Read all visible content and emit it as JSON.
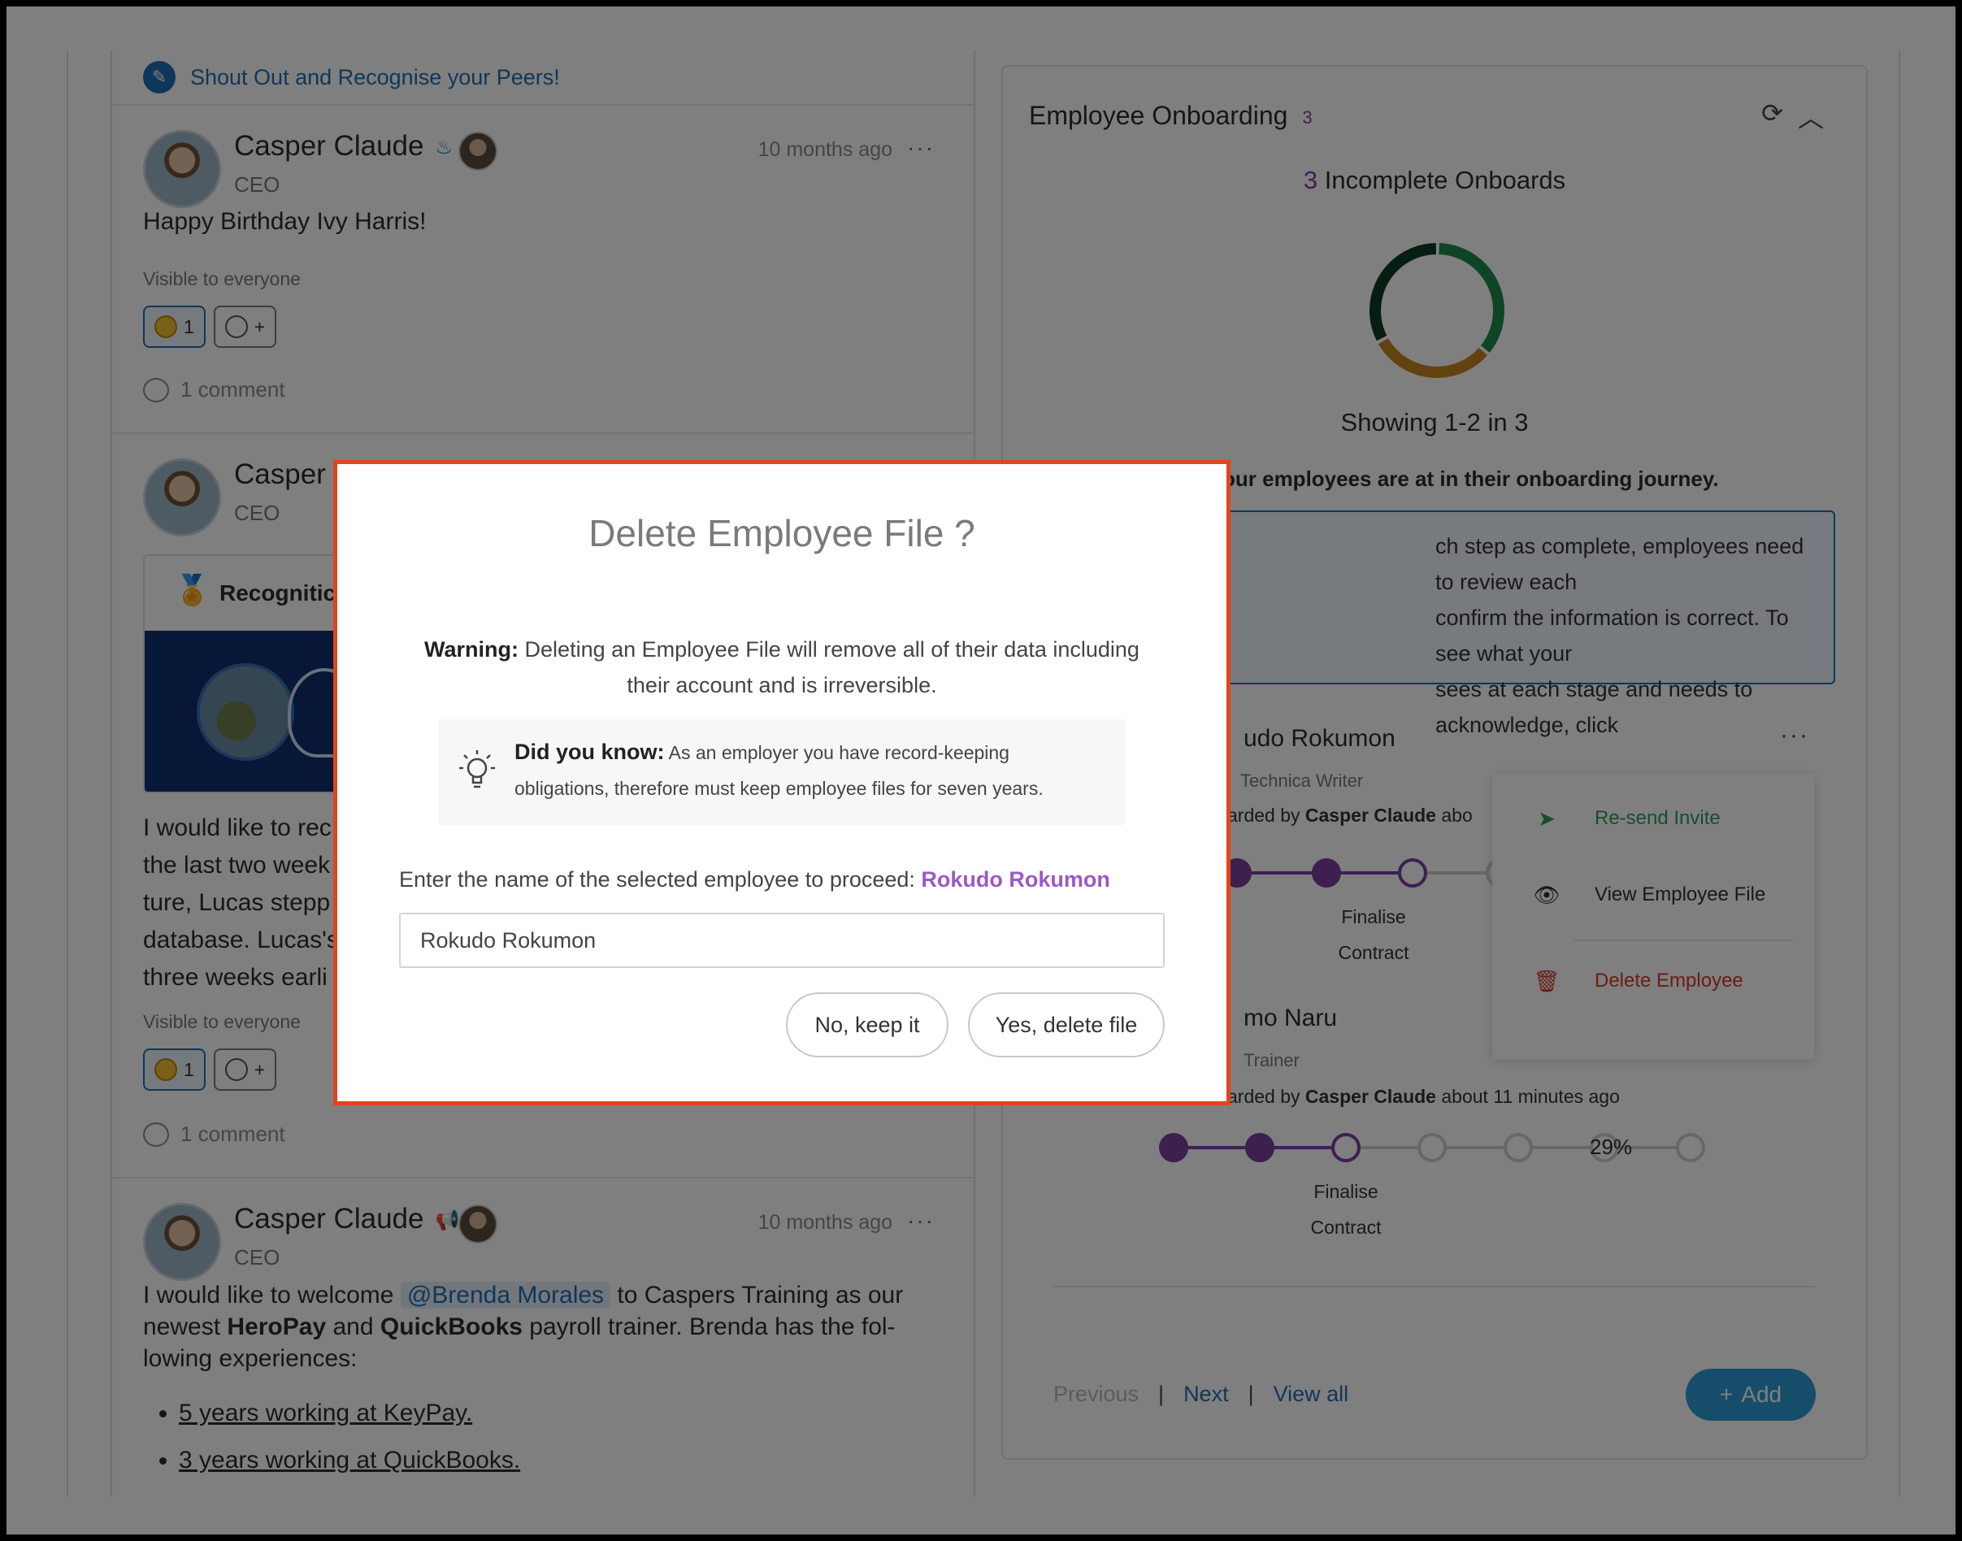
{
  "feed": {
    "shout_label": "Shout Out and Recognise your Peers!",
    "posts": [
      {
        "author": "Casper Claude",
        "role": "CEO",
        "time": "10 months ago",
        "more": "···",
        "text": "Happy Birthday Ivy Harris!",
        "visibility": "Visible to everyone",
        "reaction_count": "1",
        "add_reaction": "+",
        "comments": "1 comment"
      },
      {
        "author": "Casper",
        "role": "CEO",
        "recognition_label": "Recognitic",
        "text_lines": [
          "I would like to rec",
          "the last two week",
          "ture, Lucas stepp",
          "database. Lucas's",
          "three weeks earli"
        ],
        "visibility": "Visible to everyone",
        "reaction_count": "1",
        "add_reaction": "+",
        "comments": "1 comment"
      },
      {
        "author": "Casper Claude",
        "role": "CEO",
        "time": "10 months ago",
        "more": "···",
        "text_pre": "I would like to welcome",
        "mention": "@Brenda Morales",
        "text_mid": "to Caspers Training as our",
        "line2_pre": "newest",
        "bold1": "HeroPay",
        "line2_and": "and",
        "bold2": "QuickBooks",
        "line2_post": "payroll trainer. Brenda has the fol-",
        "line3": "lowing experiences:",
        "bullets": [
          "5 years working at KeyPay.",
          "3 years working at QuickBooks."
        ]
      }
    ]
  },
  "onboarding": {
    "title": "Employee Onboarding",
    "count": "3",
    "incomplete_count": "3",
    "incomplete_label": "Incomplete Onboards",
    "showing": "Showing 1-2 in 3",
    "journey_text": "our employees are at in their onboarding journey.",
    "info_lines": [
      "ch step as complete, employees need to review each",
      "confirm the information is correct. To see what your",
      "sees at each stage and needs to acknowledge, click"
    ],
    "employees": [
      {
        "name": "udo Rokumon",
        "role": "Technica Writer",
        "onboarded_pre": "arded by",
        "onboarded_by": "Casper Claude",
        "onboarded_post": "abo",
        "step_label_1": "Finalise",
        "step_label_2": "Contract",
        "more": "···"
      },
      {
        "name": "mo Naru",
        "role": "Trainer",
        "onboarded_pre": "arded by",
        "onboarded_by": "Casper Claude",
        "onboarded_post": "about 11 minutes ago",
        "step_label_1": "Finalise",
        "step_label_2": "Contract",
        "progress_pct": 29,
        "progress_text": "29%"
      }
    ],
    "donut": [
      {
        "label": "green",
        "fraction": 0.36,
        "color": "#1f8a4c"
      },
      {
        "label": "orange",
        "fraction": 0.31,
        "color": "#c5871f"
      },
      {
        "label": "dark",
        "fraction": 0.33,
        "color": "#0d3b22"
      }
    ],
    "pager": {
      "previous": "Previous",
      "sep": "|",
      "next": "Next",
      "view_all": "View all"
    },
    "add_label": "Add"
  },
  "context_menu": {
    "resend": "Re-send Invite",
    "view": "View Employee File",
    "delete": "Delete Employee"
  },
  "modal": {
    "title": "Delete Employee File ?",
    "warning_label": "Warning:",
    "warning_line1": "Deleting an Employee File will remove all of their data including",
    "warning_line2": "their account and is irreversible.",
    "tip_label": "Did you know:",
    "tip_line1": "As an employer you have record-keeping",
    "tip_line2": "obligations, therefore must keep employee files for seven years.",
    "prompt": "Enter the name of the selected employee to proceed:",
    "employee_name": "Rokudo Rokumon",
    "input_value": "Rokudo Rokumon",
    "cancel_label": "No, keep it",
    "confirm_label": "Yes, delete file"
  },
  "colors": {
    "accent_purple": "#7b3fa0",
    "link_blue": "#1f6fb5",
    "danger": "#e0451d",
    "add_button": "#2a9bd6"
  }
}
